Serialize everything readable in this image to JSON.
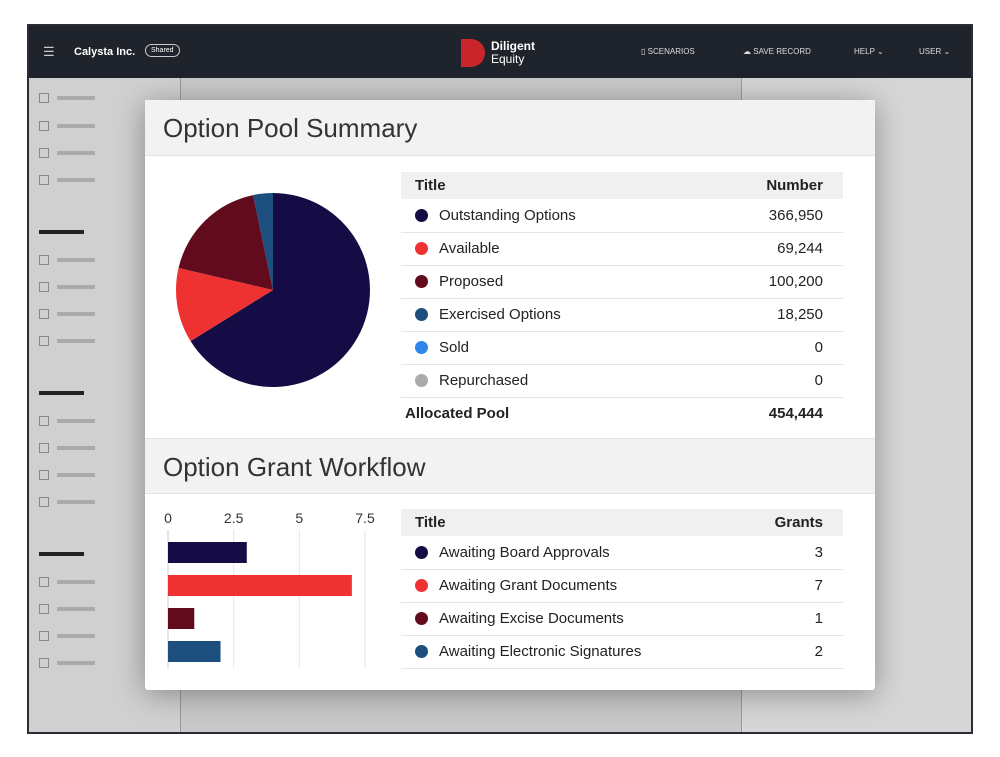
{
  "header": {
    "company": "Calysta Inc.",
    "badge": "Shared",
    "brand": "Diligent",
    "brand_sub": "Equity",
    "nav": [
      "SCENARIOS",
      "SAVE RECORD",
      "HELP",
      "USER"
    ]
  },
  "pool": {
    "title": "Option Pool Summary",
    "col_title": "Title",
    "col_number": "Number",
    "rows": [
      {
        "label": "Outstanding Options",
        "value": "366,950",
        "num": 366950,
        "color": "#160c45"
      },
      {
        "label": "Available",
        "value": "69,244",
        "num": 69244,
        "color": "#ee3131"
      },
      {
        "label": "Proposed",
        "value": "100,200",
        "num": 100200,
        "color": "#620b1d"
      },
      {
        "label": "Exercised Options",
        "value": "18,250",
        "num": 18250,
        "color": "#1c4f7d"
      },
      {
        "label": "Sold",
        "value": "0",
        "num": 0,
        "color": "#2e86e8"
      },
      {
        "label": "Repurchased",
        "value": "0",
        "num": 0,
        "color": "#aaaaaa"
      }
    ],
    "total_label": "Allocated Pool",
    "total_value": "454,444"
  },
  "workflow": {
    "title": "Option Grant Workflow",
    "col_title": "Title",
    "col_grants": "Grants",
    "rows": [
      {
        "label": "Awaiting Board Approvals",
        "value": "3",
        "color": "#160c45"
      },
      {
        "label": "Awaiting Grant Documents",
        "value": "7",
        "color": "#ee3131"
      },
      {
        "label": "Awaiting Excise Documents",
        "value": "1",
        "color": "#620b1d"
      },
      {
        "label": "Awaiting Electronic Signatures",
        "value": "2",
        "color": "#1c4f7d"
      }
    ]
  },
  "chart_data": [
    {
      "type": "pie",
      "categories": [
        "Outstanding Options",
        "Available",
        "Proposed",
        "Exercised Options",
        "Sold",
        "Repurchased"
      ],
      "values": [
        366950,
        69244,
        100200,
        18250,
        0,
        0
      ]
    },
    {
      "type": "bar",
      "orientation": "horizontal",
      "categories": [
        "Awaiting Board Approvals",
        "Awaiting Grant Documents",
        "Awaiting Excise Documents",
        "Awaiting Electronic Signatures"
      ],
      "values": [
        3,
        7,
        1,
        2
      ],
      "xlim": [
        0,
        7.5
      ],
      "xticks": [
        "0",
        "2.5",
        "5",
        "7.5"
      ],
      "grid": true
    }
  ]
}
